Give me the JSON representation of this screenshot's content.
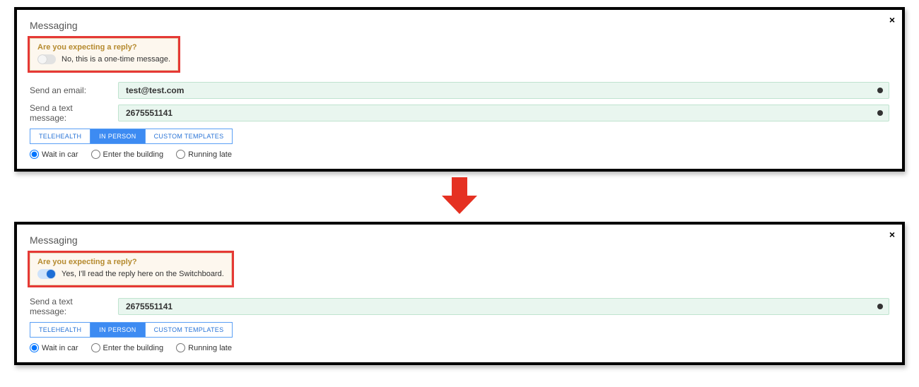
{
  "panel1": {
    "title": "Messaging",
    "reply": {
      "question": "Are you expecting a reply?",
      "toggle_on": false,
      "answer": "No, this is a one-time message."
    },
    "email": {
      "label": "Send an email:",
      "value": "test@test.com"
    },
    "text": {
      "label": "Send a text message:",
      "value": "2675551141"
    },
    "tabs": [
      "TELEHEALTH",
      "IN PERSON",
      "CUSTOM TEMPLATES"
    ],
    "tab_active_index": 1,
    "radios": [
      "Wait in car",
      "Enter the building",
      "Running late"
    ],
    "radio_selected_index": 0
  },
  "panel2": {
    "title": "Messaging",
    "reply": {
      "question": "Are you expecting a reply?",
      "toggle_on": true,
      "answer": "Yes, I'll read the reply here on the Switchboard."
    },
    "text": {
      "label": "Send a text message:",
      "value": "2675551141"
    },
    "tabs": [
      "TELEHEALTH",
      "IN PERSON",
      "CUSTOM TEMPLATES"
    ],
    "tab_active_index": 1,
    "radios": [
      "Wait in car",
      "Enter the building",
      "Running late"
    ],
    "radio_selected_index": 0
  }
}
